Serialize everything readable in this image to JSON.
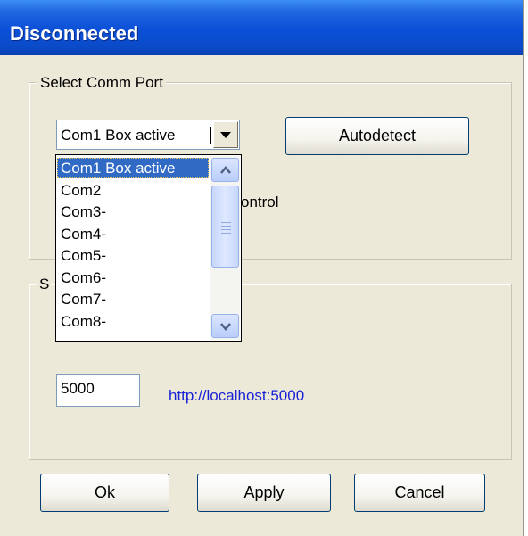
{
  "window": {
    "title": "Disconnected"
  },
  "comm_group": {
    "legend": "Select Comm Port",
    "selected_port": "Com1 Box active",
    "autodetect_label": "Autodetect",
    "partial_label": "ontrol",
    "dropdown_options": [
      "Com1 Box active",
      "Com2",
      "Com3-",
      "Com4-",
      "Com5-",
      "Com6-",
      "Com7-",
      "Com8-"
    ]
  },
  "server_group": {
    "legend_partial": "S",
    "port_value": "5000",
    "url": "http://localhost:5000"
  },
  "buttons": {
    "ok": "Ok",
    "apply": "Apply",
    "cancel": "Cancel"
  },
  "colors": {
    "title_bar": "#0a4fd6",
    "dialog_bg": "#ece9d8",
    "selection": "#316ac5",
    "link": "#1a22d6"
  },
  "icons": {
    "combo_arrow": "chevron-down-icon",
    "scroll_up": "chevron-up-icon",
    "scroll_down": "chevron-down-icon"
  }
}
